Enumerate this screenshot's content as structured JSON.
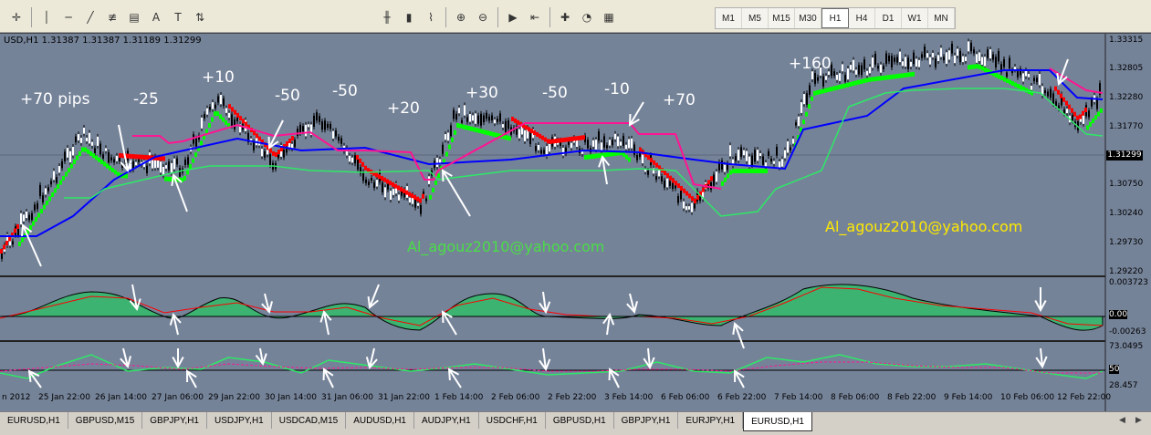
{
  "symbol_info": "USD,H1  1.31387 1.31387 1.31189 1.31299",
  "current_price": "1.31299",
  "timeframes": [
    "M1",
    "M5",
    "M15",
    "M30",
    "H1",
    "H4",
    "D1",
    "W1",
    "MN"
  ],
  "active_timeframe": "H1",
  "price_scale": [
    "1.33315",
    "1.32805",
    "1.32280",
    "1.31770",
    "1.31299",
    "1.30750",
    "1.30240",
    "1.29730",
    "1.29220"
  ],
  "osc1_scale": [
    "0.003723",
    "0.00",
    "-0.00263"
  ],
  "osc2_scale": [
    "73.0495",
    "50",
    "28.457"
  ],
  "annotations": [
    "+70 pips",
    "-25",
    "+10",
    "-50",
    "-50",
    "+20",
    "+30",
    "-50",
    "-10",
    "+70",
    "+160"
  ],
  "emails": [
    "Al_agouz2010@yahoo.com",
    "Al_agouz2010@yahoo.com"
  ],
  "time_labels": [
    "n 2012",
    "25 Jan 22:00",
    "26 Jan 14:00",
    "27 Jan 06:00",
    "29 Jan 22:00",
    "30 Jan 14:00",
    "31 Jan 06:00",
    "31 Jan 22:00",
    "1 Feb 14:00",
    "2 Feb 06:00",
    "2 Feb 22:00",
    "3 Feb 14:00",
    "6 Feb 06:00",
    "6 Feb 22:00",
    "7 Feb 14:00",
    "8 Feb 06:00",
    "8 Feb 22:00",
    "9 Feb 14:00",
    "10 Feb 06:00",
    "12 Feb 22:00"
  ],
  "tabs": [
    "EURUSD,H1",
    "GBPUSD,M15",
    "GBPJPY,H1",
    "USDJPY,H1",
    "USDCAD,M15",
    "AUDUSD,H1",
    "AUDJPY,H1",
    "USDCHF,H1",
    "GBPUSD,H1",
    "GBPJPY,H1",
    "EURJPY,H1",
    "EURUSD,H1"
  ],
  "active_tab": "EURUSD,H1",
  "colors": {
    "chart_bg": "#758399",
    "ma_blue": "#0000ff",
    "line_pink": "#ff1493",
    "bull": "#00ff00",
    "bear": "#ff0000",
    "osc_fill": "#3cb371"
  }
}
